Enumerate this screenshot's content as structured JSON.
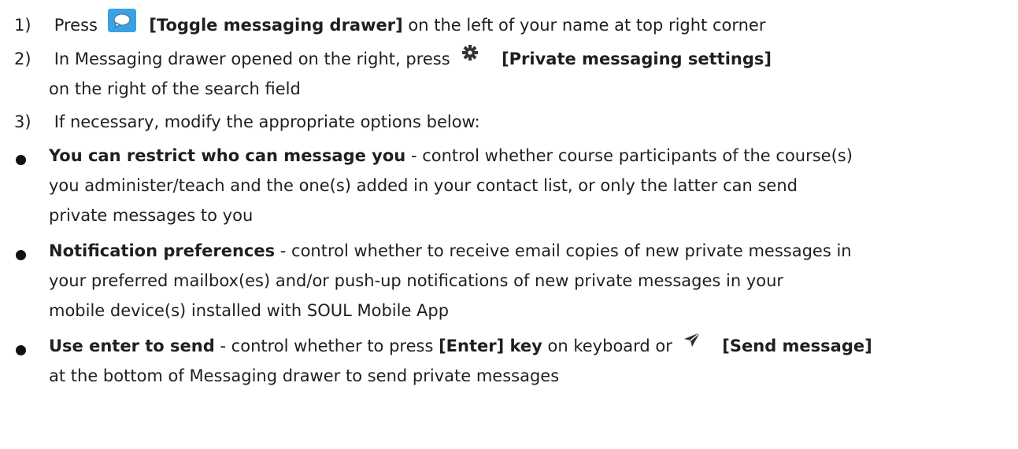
{
  "steps": [
    {
      "num": "1)",
      "pre": "Press",
      "icon": "toggle-messaging-drawer-icon",
      "bold": "[Toggle messaging drawer]",
      "post": " on the left of your name at top right corner"
    },
    {
      "num": "2)",
      "pre": "In Messaging drawer opened on the right, press",
      "icon": "gear-icon",
      "bold": "[Private messaging settings]",
      "line2": "on the right of the search field"
    },
    {
      "num": "3)",
      "text": "If necessary, modify the appropriate options below:"
    }
  ],
  "bullets": [
    {
      "title": "You can restrict who can message you",
      "line1": " - control whether course participants of the course(s)",
      "line2": "you administer/teach and the one(s) added in your contact list, or only the latter can send",
      "line3": "private messages to you"
    },
    {
      "title": "Notification preferences",
      "line1": " - control whether to receive email copies of new private messages in",
      "line2": "your preferred mailbox(es) and/or push-up notifications of new private messages in your",
      "line3": "mobile device(s) installed with SOUL Mobile App"
    },
    {
      "title": "Use enter to send",
      "line1_a": " - control whether to press ",
      "line1_bold": "[Enter] key",
      "line1_b": " on keyboard or",
      "icon": "send-icon",
      "line1_bold2": "[Send message]",
      "line2": "at the bottom of Messaging drawer to send private messages"
    }
  ],
  "colors": {
    "accent": "#3aa1e2",
    "text": "#1f1f1f"
  }
}
